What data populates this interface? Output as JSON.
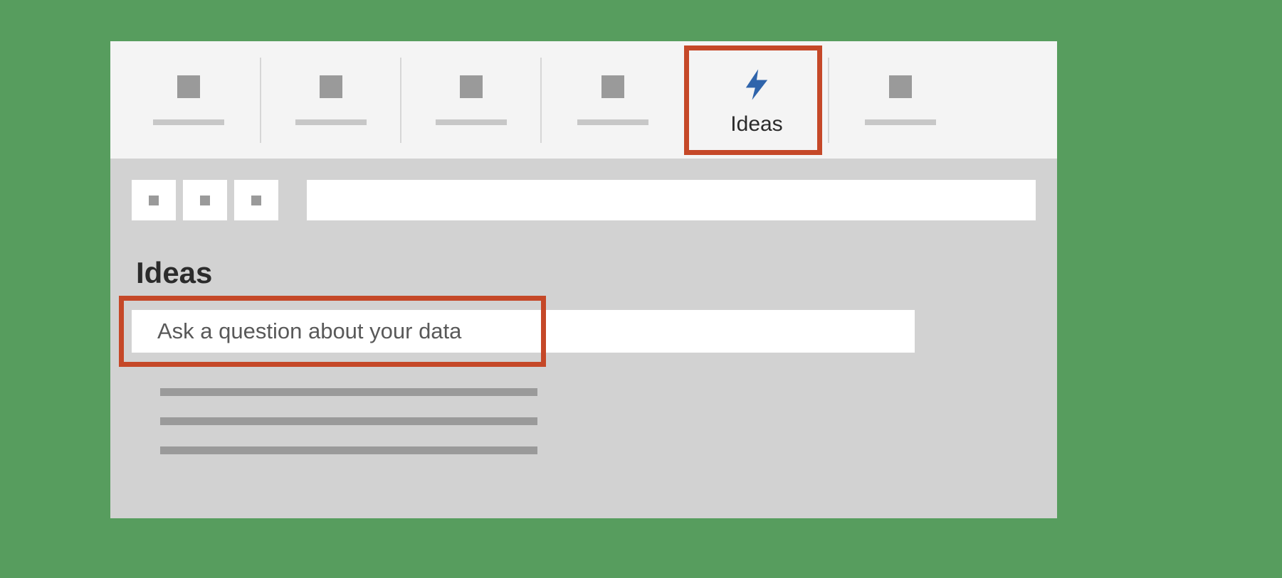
{
  "ribbon": {
    "ideas_label": "Ideas"
  },
  "panel": {
    "title": "Ideas",
    "question_placeholder": "Ask a question about your data"
  },
  "colors": {
    "highlight": "#c54828",
    "accent": "#2f64ab",
    "page_bg": "#579d5e"
  }
}
